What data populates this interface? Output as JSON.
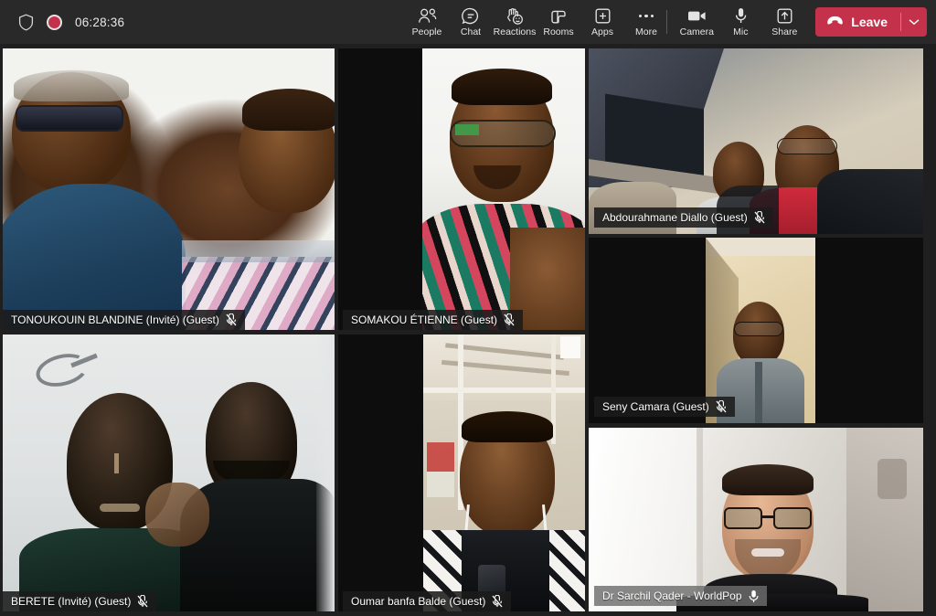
{
  "app": {
    "title": "Microsoft Teams Meeting",
    "bg_color": "#1f1f1f",
    "toolbar_color": "#292929",
    "accent_color": "#c4314b"
  },
  "topbar": {
    "left": {
      "shield_icon": "shield-icon",
      "recording_icon": "recording-indicator",
      "timer": "06:28:36"
    },
    "center_items": [
      {
        "label": "People",
        "icon": "people-icon"
      },
      {
        "label": "Chat",
        "icon": "chat-icon"
      },
      {
        "label": "Reactions",
        "icon": "reactions-icon"
      },
      {
        "label": "Rooms",
        "icon": "rooms-icon"
      },
      {
        "label": "Apps",
        "icon": "apps-icon"
      },
      {
        "label": "More",
        "icon": "more-icon"
      }
    ],
    "right_items": [
      {
        "label": "Camera",
        "icon": "camera-icon"
      },
      {
        "label": "Mic",
        "icon": "mic-icon"
      },
      {
        "label": "Share",
        "icon": "share-icon"
      }
    ],
    "leave": {
      "label": "Leave",
      "icon": "hangup-icon",
      "caret_icon": "chevron-down-icon",
      "color": "#c4314b"
    }
  },
  "stage": {
    "participants": [
      {
        "name": "TONOUKOUIN BLANDINE (Invité) (Guest)",
        "muted": true,
        "mic_icon": "mic-off-icon",
        "active_speaker": false
      },
      {
        "name": "SOMAKOU ÉTIENNE (Guest)",
        "muted": true,
        "mic_icon": "mic-off-icon",
        "active_speaker": false
      },
      {
        "name": "Abdourahmane Diallo (Guest)",
        "muted": true,
        "mic_icon": "mic-off-icon",
        "active_speaker": false
      },
      {
        "name": "Seny Camara (Guest)",
        "muted": true,
        "mic_icon": "mic-off-icon",
        "active_speaker": false
      },
      {
        "name": "BERETE (Invité) (Guest)",
        "muted": true,
        "mic_icon": "mic-off-icon",
        "active_speaker": false
      },
      {
        "name": "Oumar banfa Balde (Guest)",
        "muted": true,
        "mic_icon": "mic-off-icon",
        "active_speaker": false
      },
      {
        "name": "Dr Sarchil Qader - WorldPop",
        "muted": false,
        "mic_icon": "mic-on-icon",
        "active_speaker": true
      }
    ]
  }
}
